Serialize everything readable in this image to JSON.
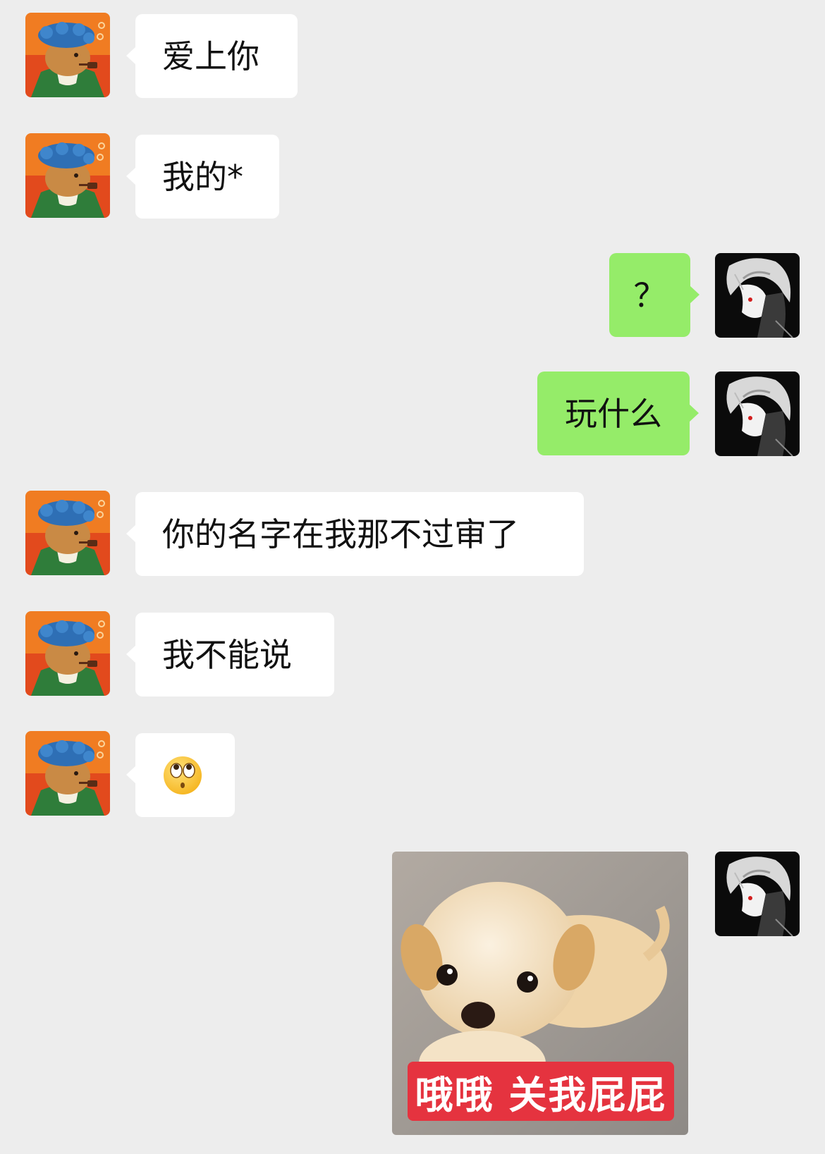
{
  "messages": [
    {
      "sender": "contact",
      "text": "爱上你"
    },
    {
      "sender": "contact",
      "text": "我的*"
    },
    {
      "sender": "me",
      "text": "？"
    },
    {
      "sender": "me",
      "text": "玩什么"
    },
    {
      "sender": "contact",
      "text": "你的名字在我那不过审了"
    },
    {
      "sender": "contact",
      "text": "我不能说"
    },
    {
      "sender": "contact",
      "icon": "rolling-eyes-emoji-icon"
    },
    {
      "sender": "me",
      "sticker": "puppy-sticker",
      "caption": "哦哦 关我屁屁"
    }
  ],
  "colors": {
    "background": "#ededed",
    "incoming_bubble": "#ffffff",
    "outgoing_bubble": "#95ec69"
  }
}
